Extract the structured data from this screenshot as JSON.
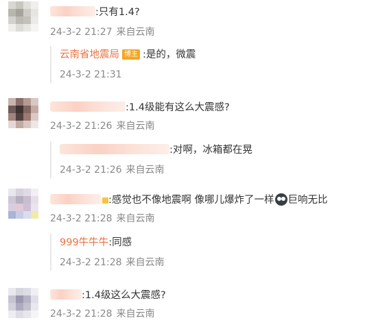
{
  "comments": [
    {
      "text": ":只有1.4?",
      "date": "24-3-2 21:27",
      "source": "来自云南",
      "replies": [
        {
          "username": "云南省地震局",
          "badge": "博主",
          "text": ":是的，微震",
          "date": "24-3-2 21:31"
        }
      ]
    },
    {
      "text": ":1.4级能有这么大震感?",
      "date": "24-3-2 21:26",
      "source": "来自云南",
      "replies": [
        {
          "text": ":对啊，冰箱都在晃",
          "date": "24-3-2 21:26",
          "source": "来自云南"
        }
      ]
    },
    {
      "text_before_emoji": ":感觉也不像地震啊 像哪儿爆炸了一样",
      "emoji_icon": "scared-face-emoji",
      "text_after_emoji": "巨响无比",
      "date": "24-3-2 21:28",
      "source": "来自云南",
      "replies": [
        {
          "username": "999牛牛牛",
          "text": ":同感",
          "date": "24-3-2 21:28",
          "source": "来自云南"
        }
      ]
    },
    {
      "text": ":1.4级这么大震感?",
      "date": "24-3-2 21:28",
      "source": "来自云南",
      "replies": []
    }
  ],
  "colors": {
    "username_link": "#eb7340",
    "badge": "#f5a623",
    "meta_text": "#888888",
    "body_text": "#333333"
  }
}
